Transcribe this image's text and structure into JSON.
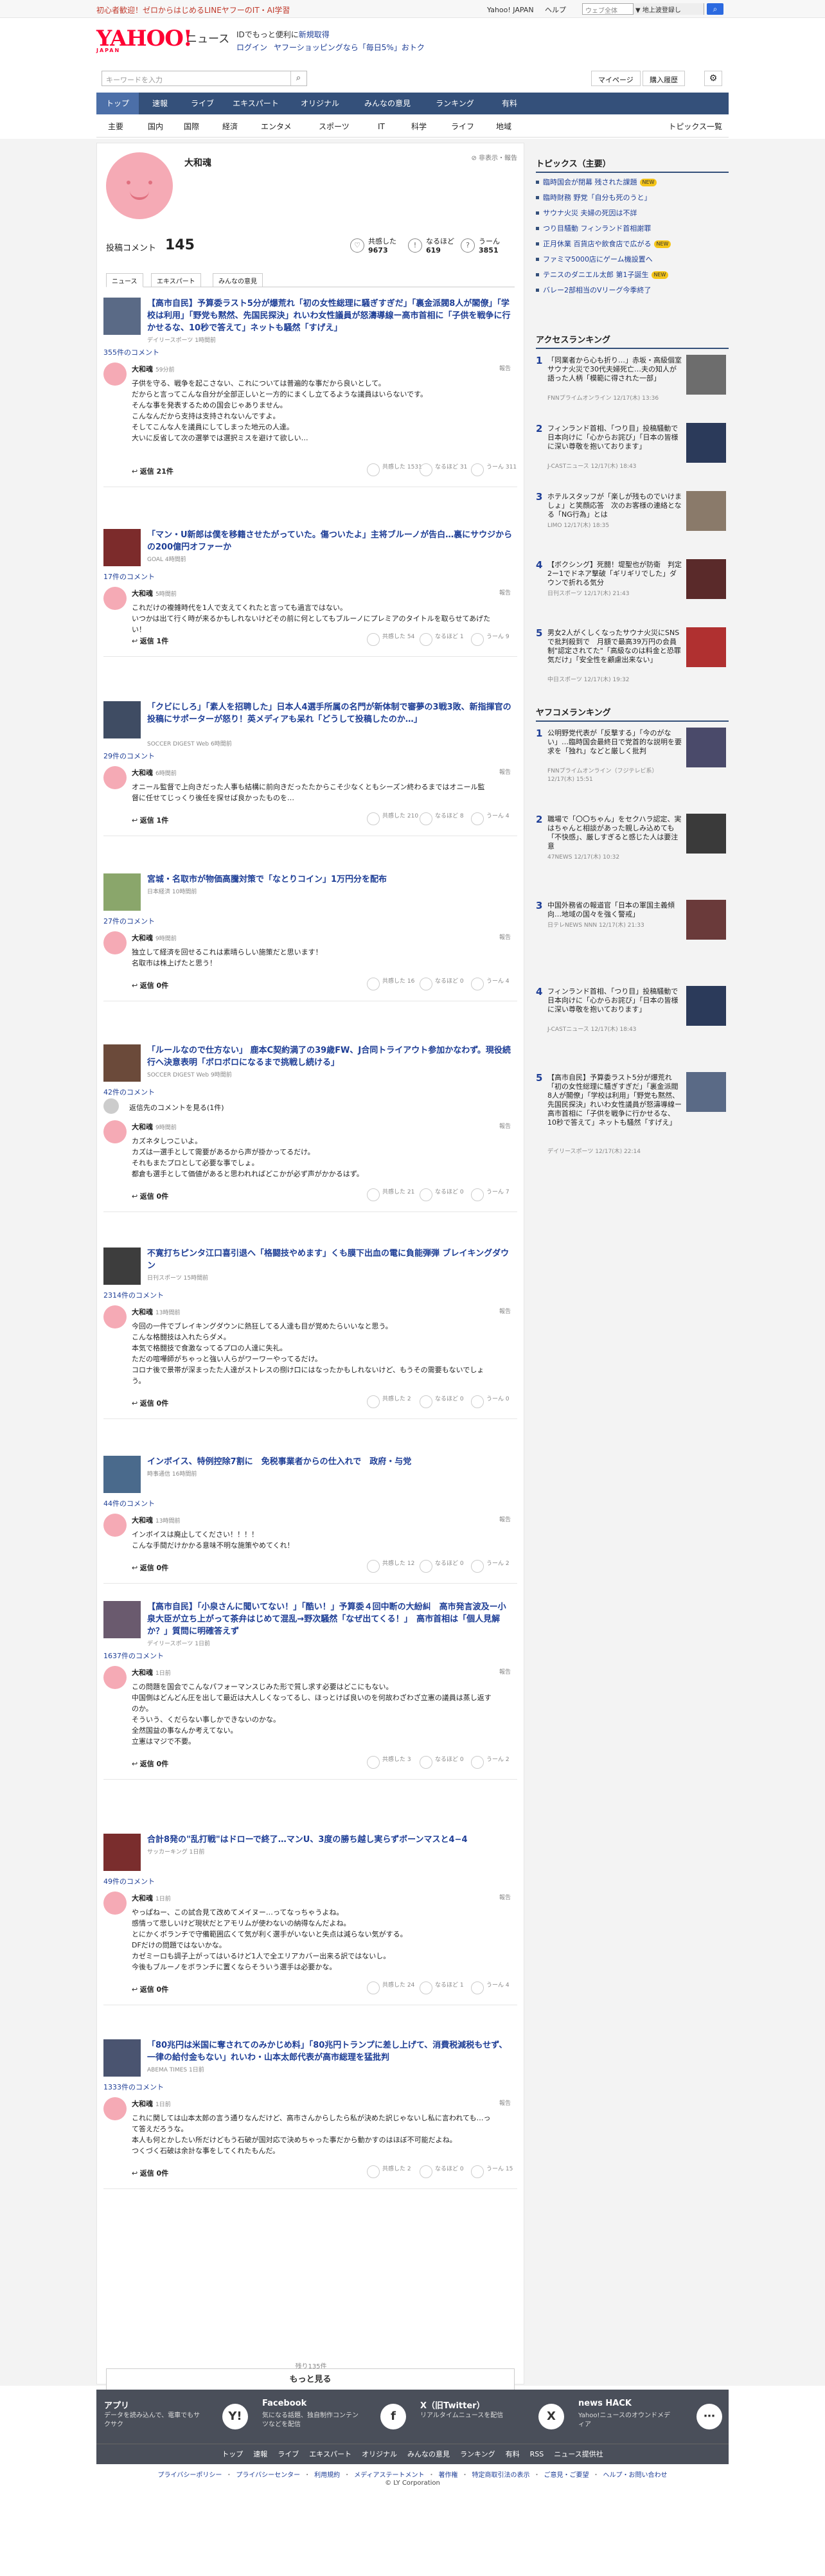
{
  "topbar": {
    "promo_prefix": "初心者歓迎！ゼロからはじめるLINEヤフーのIT・AI学習",
    "links": [
      "Yahoo! JAPAN",
      "ヘルプ"
    ],
    "search_placeholder": "ウェブ全体",
    "search_mode": "▼ 地上波登録し",
    "search_icon": "search-icon"
  },
  "header": {
    "logo_text": "YAHOO!",
    "logo_sub": "JAPAN",
    "section": "ニュース",
    "info_prefix": "IDでもっと便利に",
    "info_link": "新規取得",
    "login": "ログイン",
    "promo": "ヤフーショッピングなら「毎日5%」おトク"
  },
  "searchbar": {
    "placeholder": "キーワードを入力",
    "mypage": "マイページ",
    "buy": "購入履歴"
  },
  "mainnav": [
    "トップ",
    "速報",
    "ライブ",
    "エキスパート",
    "オリジナル",
    "みんなの意見",
    "ランキング",
    "有料"
  ],
  "subnav": [
    "主要",
    "国内",
    "国際",
    "経済",
    "エンタメ",
    "スポーツ",
    "IT",
    "科学",
    "ライフ",
    "地域"
  ],
  "subnav_right": "トピックス一覧",
  "profile": {
    "name": "大和魂",
    "report": "非表示・報告",
    "count_label": "投稿コメント",
    "count": "145",
    "stats": [
      {
        "icon": "thumbs-up-icon",
        "label": "共感した",
        "value": "9673"
      },
      {
        "icon": "lightbulb-icon",
        "label": "なるほど",
        "value": "619"
      },
      {
        "icon": "hmm-icon",
        "label": "うーん",
        "value": "3851"
      }
    ],
    "tabs": [
      "ニュース",
      "エキスパート",
      "みんなの意見"
    ]
  },
  "articles": [
    {
      "title": "【高市自民】予算委ラスト5分が爆荒れ「初の女性総理に騒ぎすぎだ」「裏金派閥8人が閣僚」「学校は利用」「野党も黙然、先国民探決」れいわ女性議員が怒濤導線ー高市首相に「子供を戦争に行かせるな、10秒で答えて」ネットも騒然「すげえ」",
      "source": "デイリースポーツ 1時間前",
      "comments": "355件のコメント",
      "time": "59分前",
      "body": "子供を守る、戦争を起こさない、これについては普遍的な事だから良いとして。\nだからと言ってこんな自分が全部正しいと一方的にまくし立てるような議員はいらないです。\nそんな事を発表するための国会じゃありません。\nこんなんだから支持は支持されないんですよ。\nそしてこんな人を議員にしてしまった地元の人達。\n大いに反省して次の選挙では選択ミスを避けて欲しい…",
      "reply": "返信 21件",
      "reacts": [
        "共感した 1531",
        "なるほど 31",
        "うーん 311"
      ]
    },
    {
      "title": "「マン・U新郎は僕を移籍させたがっていた。傷ついたよ」主将ブルーノが告白…裏にサウジからの200億円オファーか",
      "source": "GOAL 4時間前",
      "comments": "17件のコメント",
      "time": "5時間前",
      "body": "これだけの複雑時代を1人で支えてくれたと言っても過言ではない。\nいつかは出て行く時が来るかもしれないけどその前に何としてもブルーノにプレミアのタイトルを取らせてあげたい！",
      "reply": "返信 1件",
      "reacts": [
        "共感した 54",
        "なるほど 1",
        "うーん 9"
      ]
    },
    {
      "title": "「クビにしろ」「素人を招聘した」日本人4選手所属の名門が新体制で審夢の3戦3敗、新指揮官の投稿にサポーターが怒り！英メディアも呆れ「どうして投稿したのか…」",
      "source": "SOCCER DIGEST Web 6時間前",
      "comments": "29件のコメント",
      "time": "6時間前",
      "body": "オニール監督で上向きだった人事も結構に前向きだったたからこそ少なくともシーズン終わるまではオニール監督に任せてじっくり後任を探せば良かったものを…",
      "reply": "返信 1件",
      "reacts": [
        "共感した 210",
        "なるほど 8",
        "うーん 4"
      ]
    },
    {
      "title": "宮城・名取市が物価高騰対策で「なとりコイン」1万円分を配布",
      "source": "日本経済 10時間前",
      "comments": "27件のコメント",
      "time": "9時間前",
      "body": "独立して経済を回せるこれは素晴らしい施策だと思います！\n名取市は株上げたと思う！",
      "reply": "返信 0件",
      "reacts": [
        "共感した 16",
        "なるほど 0",
        "うーん 4"
      ]
    },
    {
      "title": "「ルールなので仕方ない」 鹿本C契約満了の39歳FW、J合同トライアウト参加かなわず。現役続行へ決意表明「ボロボロになるまで挑戦し続ける」",
      "source": "SOCCER DIGEST Web 9時間前",
      "comments": "42件のコメント",
      "notice": "返信先のコメントを見る(1件)",
      "time": "9時間前",
      "body": "カズネタしつこいよ。\nカズは一選手として需要があるから声が掛かってるだけ。\nそれもまたプロとして必要な事でしょ。\n都倉も選手として価値があると思われればどこかが必ず声がかかるはず。",
      "reply": "返信 0件",
      "reacts": [
        "共感した 21",
        "なるほど 0",
        "うーん 7"
      ]
    },
    {
      "title": "不寛打ちピンタ江口喜引退へ「格闘技やめます」くも膜下出血の電に負能弾弾 ブレイキングダウン",
      "source": "日刊スポーツ 15時間前",
      "comments": "2314件のコメント",
      "time": "13時間前",
      "body": "今回の一件でブレイキングダウンに熱狂してる人達も目が覚めたらいいなと思う。\nこんな格闘技は入れたらダメ。\n本気で格闘技で食激なってるプロの人達に失礼。\nただの喧嘩師がちゃっと強い人らがワーワーやってるだけ。\nコロナ後で景帯が深まったた人達がストレスの捌け口にはなったかもしれないけど、もうその需要もないでしょう。",
      "reply": "返信 0件",
      "reacts": [
        "共感した 2",
        "なるほど 0",
        "うーん 0"
      ]
    },
    {
      "title": "インボイス、特例控除7割に　免税事業者からの仕入れで　政府・与党",
      "source": "時事通信 16時間前",
      "comments": "44件のコメント",
      "time": "13時間前",
      "body": "インボイスは廃止してください！！！！\nこんな手間だけかかる意味不明な施策やめてくれ！",
      "reply": "返信 0件",
      "reacts": [
        "共感した 12",
        "なるほど 0",
        "うーん 2"
      ]
    },
    {
      "title": "【高市自民】「小泉さんに聞いてない！」「酷い！」予算委４回中断の大紛糾　高市発言波及ー小泉大臣が立ち上がって茶弁はじめて混乱→野次騒然「なぜ出てくる！」　高市首相は「個人見解か？」質問に明確答えず",
      "source": "デイリースポーツ 1日前",
      "comments": "1637件のコメント",
      "time": "1日前",
      "body": "この問題を国会でこんなパフォーマンスじみた形で質し求す必要はどこにもない。\n中国側はどんどん圧を出して最近は大人しくなってるし、ほっとけば良いのを何故わざわざ立憲の議員は蒸し返すのか。\nそういう、くだらない事しかできないのかな。\n全然国益の事なんか考えてない。\n立憲はマジで不要。",
      "reply": "返信 0件",
      "reacts": [
        "共感した 3",
        "なるほど 0",
        "うーん 2"
      ]
    },
    {
      "title": "合計8発の\"乱打戦\"はドローで終了…マンU、3度の勝ち越し実らずボーンマスと4−4",
      "source": "サッカーキング 1日前",
      "comments": "49件のコメント",
      "time": "1日前",
      "body": "やっぱねー、この試合見て改めてメイヌー…ってなっちゃうよね。\n感情って悲しいけど現状だとアモリムが使わないの納得なんだよね。\nとにかくボランチで守備範囲広くて気が利く選手がいないと失点は減らない気がする。\nDFだけの問題ではないかな。\nカゼミーロも調子上がってはいるけど1人で全エリアカバー出来る訳ではないし。\n今後もブルーノをボランチに置くならそういう選手は必要かな。",
      "reply": "返信 0件",
      "reacts": [
        "共感した 24",
        "なるほど 1",
        "うーん 4"
      ]
    },
    {
      "title": "「80兆円は米国に奪されてのみかじめ料」「80兆円トランプに差し上げて、消費税減税もせず、一律の給付金もない」れいわ・山本太郎代表が高市総理を猛批判",
      "source": "ABEMA TIMES 1日前",
      "comments": "1333件のコメント",
      "time": "1日前",
      "body": "これに関しては山本太郎の言う通りなんだけど、高市さんからしたら私が決めた訳じゃないし私に言われても…って答えだろうな。\n本人も何とかしたい所だけどもう石破が国対応で決めちゃった事だから動かすのはほぼ不可能だよね。\nつくづく石破は余計な事をしてくれたもんだ。",
      "reply": "返信 0件",
      "reacts": [
        "共感した 2",
        "なるほど 0",
        "うーん 15"
      ]
    }
  ],
  "list_footer": {
    "note": "残り135件",
    "more": "もっと見る"
  },
  "topics": {
    "header": "トピックス（主要）",
    "items": [
      {
        "text": "臨時国会が閉幕 残された課題",
        "badge": "NEW"
      },
      {
        "text": "臨時財務 野党「自分も死のうと」",
        "badge": ""
      },
      {
        "text": "サウナ火災 夫婦の死因は不詳",
        "badge": ""
      },
      {
        "text": "つり目騒動 フィンランド首相謝罪",
        "badge": ""
      },
      {
        "text": "正月休業 百貨店や飲食店で広がる",
        "badge": "NEW"
      },
      {
        "text": "ファミマ5000店にゲーム機設置へ",
        "badge": ""
      },
      {
        "text": "テニスのダニエル太郎 第1子誕生",
        "badge": "NEW"
      },
      {
        "text": "バレー2部相当のVリーグ今季終了",
        "badge": ""
      }
    ]
  },
  "access_ranking": {
    "header": "アクセスランキング",
    "items": [
      {
        "num": "1",
        "title": "「同業者から心も折り…」赤坂・高級個室サウナ火災で30代夫婦死亡…夫の知人が語った人柄「模範に得された一部」",
        "src": "FNNプライムオンライン 12/17(木) 13:36"
      },
      {
        "num": "2",
        "title": "フィンランド首相、「つり目」投稿騒動で日本向けに「心からお詫び」「日本の皆様に深い尊敬を抱いております」",
        "src": "J-CASTニュース 12/17(木) 18:43"
      },
      {
        "num": "3",
        "title": "ホテルスタッフが「楽しが残ものでいけましょ」と笑顔応答　次のお客様の連絡となる「NG行為」とは",
        "src": "LIMO 12/17(木) 18:35"
      },
      {
        "num": "4",
        "title": "【ボクシング】死闘！堤聖也が防衛　判定2ー1でドネア撃破「ギリギリでした」ダウンで折れる気分",
        "src": "日刊スポーツ 12/17(木) 21:43"
      },
      {
        "num": "5",
        "title": "男女2人がくしくなったサウナ火災にSNSで批判殺到で　月額で最高39万円の会員制\"認定されてた\"「高級なのは料金と恐罪気だけ」「安全性を顧慮出来ない」",
        "src": "中日スポーツ 12/17(木) 19:32"
      }
    ]
  },
  "comment_ranking": {
    "header": "ヤフコメランキング",
    "items": [
      {
        "num": "1",
        "title": "公明野党代表が「反撃する」「今のがない」…臨時国会最終日で党首的な説明を要求を「独れ」などと厳しく批判",
        "src": "FNNプライムオンライン（フジテレビ系） 12/17(木) 15:51"
      },
      {
        "num": "2",
        "title": "職場で「〇〇ちゃん」をセクハラ認定、実はちゃんと相談があった親しみ込めても「不快感」、厳しすぎると感じた人は要注意",
        "src": "47NEWS 12/17(木) 10:32"
      },
      {
        "num": "3",
        "title": "中国外務省の報道官「日本の軍国主義傾向…地域の国々を強く警戒」",
        "src": "日テレNEWS NNN 12/17(木) 21:33"
      },
      {
        "num": "4",
        "title": "フィンランド首相、「つり目」投稿騒動で日本向けに「心からお詫び」「日本の皆様に深い尊敬を抱いております」",
        "src": "J-CASTニュース 12/17(木) 18:43"
      },
      {
        "num": "5",
        "title": "【高市自民】予算委ラスト5分が爆荒れ「初の女性総理に騒ぎすぎだ」「裏金派閥8人が閣僚」「学校は利用」「野党も黙然、先国民探決」れいわ女性議員が怒濤導線ー高市首相に「子供を戦争に行かせるな、10秒で答えて」ネットも騒然「すげえ」",
        "src": "デイリースポーツ 12/17(木) 22:14"
      }
    ]
  },
  "footer": {
    "items": [
      {
        "title": "アプリ",
        "desc": "データを読み込んで、電車でもサクサク",
        "icon": "app-icon",
        "glyph": "Y!"
      },
      {
        "title": "Facebook",
        "desc": "気になる話題、独自制作コンテンツなどを配信",
        "icon": "facebook-icon",
        "glyph": "f"
      },
      {
        "title": "X（旧Twitter）",
        "desc": "リアルタイムニュースを配信",
        "icon": "x-icon",
        "glyph": "X"
      },
      {
        "title": "news HACK",
        "desc": "Yahoo!ニュースのオウンドメディア",
        "icon": "newshack-icon",
        "glyph": "⋯"
      }
    ],
    "nav": [
      "トップ",
      "速報",
      "ライブ",
      "エキスパート",
      "オリジナル",
      "みんなの意見",
      "ランキング",
      "有料",
      "RSS",
      "ニュース提供社"
    ],
    "links": [
      "プライバシーポリシー",
      "プライバシーセンター",
      "利用規約",
      "メディアステートメント",
      "著作権",
      "特定商取引法の表示",
      "ご意見・ご要望",
      "ヘルプ・お問い合わせ"
    ],
    "copyright": "© LY Corporation"
  },
  "colors": {
    "brand": "#ff0033",
    "nav": "#34507a",
    "link": "#1e3e96",
    "avatar": "#f5aab5"
  }
}
